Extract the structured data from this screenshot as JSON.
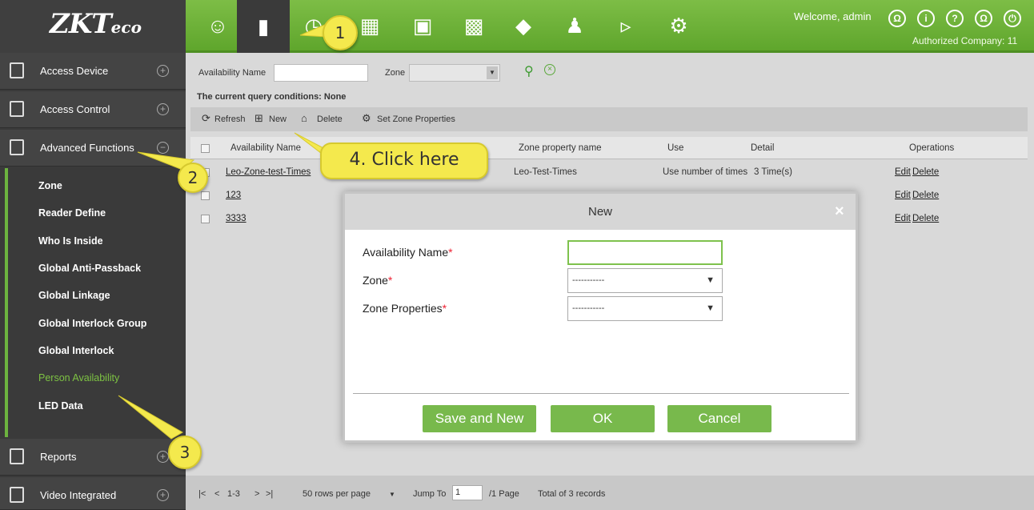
{
  "header": {
    "welcome": "Welcome, admin",
    "company": "Authorized Company: 11",
    "logo": "ZKT",
    "logo_suffix": "eco"
  },
  "sidebar": {
    "groups": [
      {
        "label": "Access Device"
      },
      {
        "label": "Access Control"
      },
      {
        "label": "Advanced Functions"
      },
      {
        "label": "Reports"
      },
      {
        "label": "Video Integrated"
      }
    ],
    "items": [
      {
        "label": "Zone"
      },
      {
        "label": "Reader Define"
      },
      {
        "label": "Who Is Inside"
      },
      {
        "label": "Global Anti-Passback"
      },
      {
        "label": "Global Linkage"
      },
      {
        "label": "Global Interlock Group"
      },
      {
        "label": "Global Interlock"
      },
      {
        "label": "Person Availability"
      },
      {
        "label": "LED Data"
      }
    ]
  },
  "query": {
    "availability_label": "Availability Name",
    "zone_label": "Zone",
    "conditions": "The current query conditions: None"
  },
  "toolbar": {
    "refresh": "Refresh",
    "new": "New",
    "delete": "Delete",
    "zone_props": "Set Zone Properties"
  },
  "table": {
    "headers": [
      "Availability Name",
      "Zone property name",
      "Use",
      "Detail",
      "Operations"
    ],
    "rows": [
      {
        "name": "Leo-Zone-test-Times",
        "property": "Leo-Test-Times",
        "use": "Use number of times",
        "detail": "3 Time(s)",
        "edit": "Edit",
        "delete": "Delete"
      },
      {
        "name": "123",
        "property": "",
        "use": "",
        "detail": "",
        "edit": "Edit",
        "delete": "Delete"
      },
      {
        "name": "3333",
        "property": "",
        "use": "",
        "detail": "",
        "edit": "Edit",
        "delete": "Delete"
      }
    ]
  },
  "pager": {
    "range": "1-3",
    "rows_per_page": "50 rows per page",
    "jump_label": "Jump To",
    "jump_value": "1",
    "pages": "/1 Page",
    "total": "Total of 3 records"
  },
  "modal": {
    "title": "New",
    "close": "×",
    "fields": [
      {
        "label": "Availability Name",
        "value": ""
      },
      {
        "label": "Zone",
        "value": "-----------"
      },
      {
        "label": "Zone Properties",
        "value": "-----------"
      }
    ],
    "required_mark": "*",
    "save_new": "Save and New",
    "ok": "OK",
    "cancel": "Cancel"
  },
  "callouts": {
    "one": "1",
    "two": "2",
    "three": "3",
    "four": "4. Click here"
  },
  "colors": {
    "brand_green": "#6cb33f",
    "callout_yellow": "#f4e94d"
  }
}
